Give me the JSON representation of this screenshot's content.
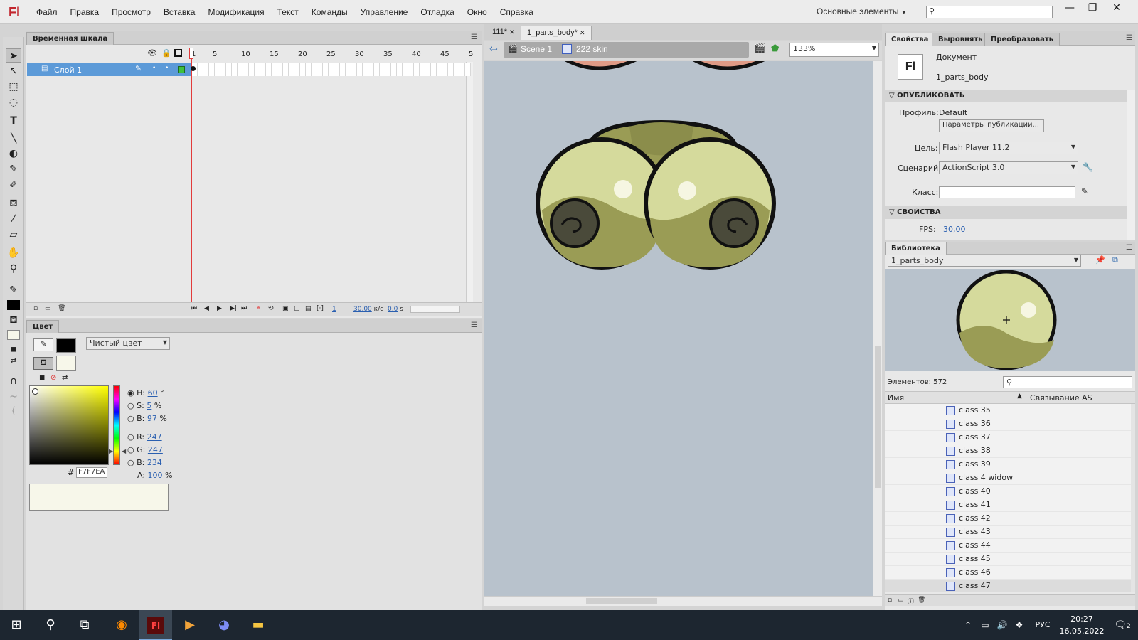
{
  "app": {
    "logo": "Fl"
  },
  "menu": [
    "Файл",
    "Правка",
    "Просмотр",
    "Вставка",
    "Модификация",
    "Текст",
    "Команды",
    "Управление",
    "Отладка",
    "Окно",
    "Справка"
  ],
  "workspace": "Основные элементы",
  "window_buttons": [
    "—",
    "❐",
    "✕"
  ],
  "timeline": {
    "tab": "Временная шкала",
    "frame_numbers": [
      "1",
      "5",
      "10",
      "15",
      "20",
      "25",
      "30",
      "35",
      "40",
      "45",
      "5"
    ],
    "layer_name": "Слой 1",
    "current_frame": "1",
    "fps": "30,00",
    "fps_unit": "к/с",
    "time": "0,0",
    "time_unit": "s"
  },
  "color": {
    "tab": "Цвет",
    "fill_type": "Чистый цвет",
    "h": "60",
    "h_unit": "°",
    "s": "5",
    "s_unit": "%",
    "b": "97",
    "b_unit": "%",
    "r": "247",
    "g": "247",
    "bb": "234",
    "a": "100",
    "a_unit": "%",
    "hex_label": "#",
    "hex": "F7F7EA",
    "labels": {
      "h": "H:",
      "s": "S:",
      "b": "B:",
      "r": "R:",
      "g": "G:",
      "b2": "B:",
      "a": "A:"
    },
    "fill_color": "#F7F7EA",
    "stroke_color": "#000000"
  },
  "document_tabs": [
    "111*",
    "1_parts_body*"
  ],
  "editbar": {
    "scene": "Scene 1",
    "symbol": "222 skin",
    "zoom": "133%"
  },
  "properties": {
    "tabs": [
      "Свойства",
      "Выровнять",
      "Преобразовать"
    ],
    "doc_type": "Документ",
    "doc_name": "1_parts_body",
    "publish_section": "ОПУБЛИКОВАТЬ",
    "profile_label": "Профиль:",
    "profile_value": "Default",
    "publish_settings_button": "Параметры публикации...",
    "target_label": "Цель:",
    "target_value": "Flash Player 11.2",
    "script_label": "Сценарий:",
    "script_value": "ActionScript 3.0",
    "class_label": "Класс:",
    "class_value": "",
    "props_section": "СВОЙСТВА",
    "fps_label": "FPS:",
    "fps_value": "30,00"
  },
  "library": {
    "tab": "Библиотека",
    "document": "1_parts_body",
    "elements_label": "Элементов: 572",
    "col_name": "Имя",
    "col_linkage": "Связывание AS",
    "items": [
      "class 35",
      "class 36",
      "class 37",
      "class 38",
      "class 39",
      "class 4 widow",
      "class 40",
      "class 41",
      "class 42",
      "class 43",
      "class 44",
      "class 45",
      "class 46",
      "class 47"
    ]
  },
  "taskbar": {
    "lang": "РУС",
    "time": "20:27",
    "date": "16.05.2022",
    "notifications": "2"
  },
  "colors": {
    "accent": "#5c9ad8",
    "stage": "#b8c2cc",
    "olive": "#d5da9c",
    "olive_dark": "#9a9c55",
    "playhead": "#e23b3b"
  }
}
